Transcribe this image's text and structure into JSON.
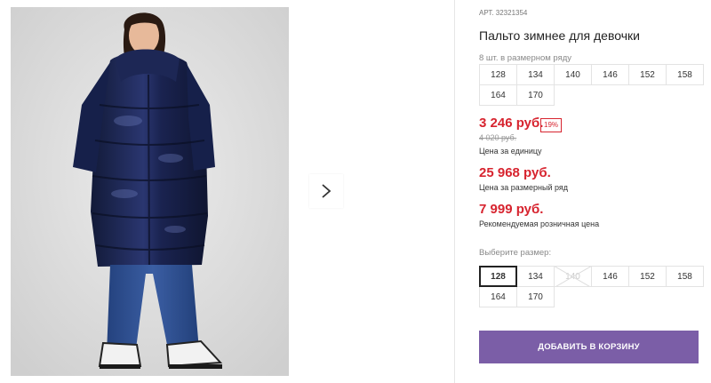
{
  "product": {
    "article_label": "АРТ.",
    "article_number": "32321354",
    "title": "Пальто зимнее для девочки",
    "photo_alt": "Девочка в тёмно-синем зимнем пальто",
    "sizes_note": "8 шт. в размерном ряду",
    "size_range": [
      "128",
      "134",
      "140",
      "146",
      "152",
      "158",
      "164",
      "170"
    ]
  },
  "pricing": {
    "price": "3 246 руб.",
    "discount": "19%",
    "old_price": "4 020 руб.",
    "price_caption": "Цена за единицу",
    "set_price": "25 968 руб.",
    "set_caption": "Цена за размерный ряд",
    "rrp": "7 999 руб.",
    "rrp_caption": "Рекомендуемая розничная цена"
  },
  "size_picker": {
    "label": "Выберите размер:",
    "selected": "128",
    "options": [
      {
        "size": "128",
        "state": "selected"
      },
      {
        "size": "134",
        "state": "available"
      },
      {
        "size": "140",
        "state": "unavailable"
      },
      {
        "size": "146",
        "state": "available"
      },
      {
        "size": "152",
        "state": "available"
      },
      {
        "size": "158",
        "state": "available"
      },
      {
        "size": "164",
        "state": "available"
      },
      {
        "size": "170",
        "state": "available"
      }
    ]
  },
  "actions": {
    "add_to_cart": "ДОБАВИТЬ В КОРЗИНУ",
    "next_icon": "chevron-right-icon"
  },
  "colors": {
    "price_red": "#d7242f",
    "button_purple": "#7b5ea7",
    "coat_navy": "#1b2347",
    "jeans_blue": "#2f4f8f"
  }
}
